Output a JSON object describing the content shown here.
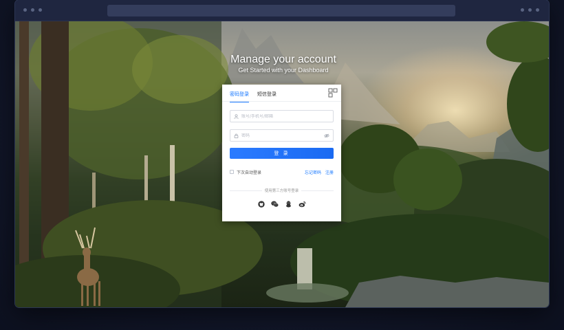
{
  "window": {
    "url": ""
  },
  "hero": {
    "title": "Manage your account",
    "subtitle": "Get Started with your Dashboard"
  },
  "login": {
    "tabs": [
      {
        "label": "密码登录",
        "active": true
      },
      {
        "label": "短信登录",
        "active": false
      }
    ],
    "username_placeholder": "账号/手机号/邮箱",
    "password_placeholder": "密码",
    "submit_label": "登 录",
    "remember_label": "下次自动登录",
    "forgot_label": "忘记密码",
    "register_label": "注册",
    "third_party_title": "使用第三方账号登录",
    "third_party_icons": [
      "github-icon",
      "wechat-icon",
      "qq-icon",
      "weibo-icon"
    ]
  },
  "colors": {
    "accent": "#1677ff",
    "page_bg": "#12172a",
    "chrome_bg": "#1f2640"
  }
}
